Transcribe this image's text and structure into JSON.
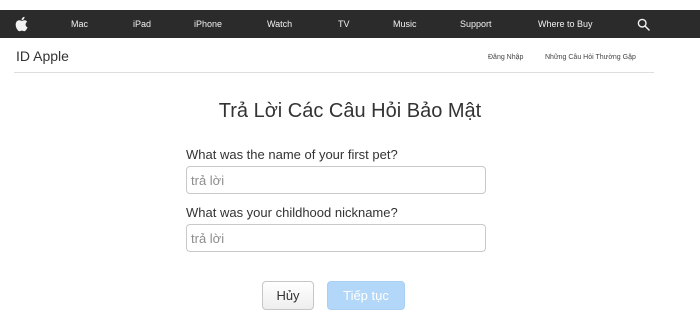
{
  "globalnav": {
    "apple_icon": "apple-logo-icon",
    "items": [
      "Mac",
      "iPad",
      "iPhone",
      "Watch",
      "TV",
      "Music",
      "Support",
      "Where to Buy"
    ],
    "search_icon": "search-icon",
    "background": "#2b2b2b"
  },
  "localnav": {
    "title": "ID Apple",
    "sign_in": "Đăng Nhập",
    "faq": "Những Câu Hỏi Thường Gặp"
  },
  "main": {
    "title": "Trả Lời Các Câu Hỏi Bảo Mật",
    "questions": [
      {
        "label": "What was the name of your first pet?",
        "value": "",
        "placeholder": "trả lời"
      },
      {
        "label": "What was your childhood nickname?",
        "value": "",
        "placeholder": "trả lời"
      }
    ],
    "cancel_label": "Hủy",
    "continue_label": "Tiếp tục",
    "continue_color": "#b3d7f8"
  }
}
